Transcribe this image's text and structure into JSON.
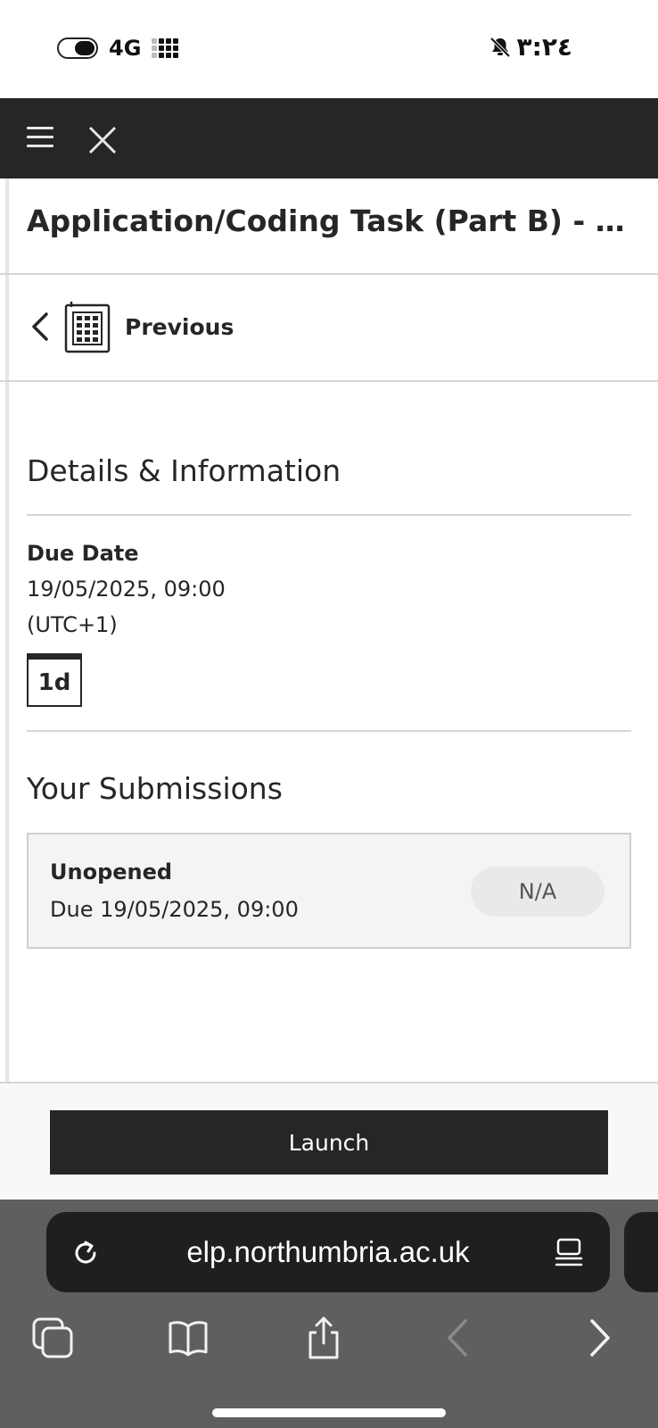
{
  "status_bar": {
    "network": "4G",
    "time": "٣:٢٤"
  },
  "header": {
    "title": "Application/Coding Task (Part B) - Subm..."
  },
  "nav": {
    "previous_label": "Previous"
  },
  "details": {
    "heading": "Details & Information",
    "due_label": "Due Date",
    "due_value": "19/05/2025, 09:00",
    "timezone": "(UTC+1)",
    "countdown_badge": "1d"
  },
  "submissions": {
    "heading": "Your Submissions",
    "items": [
      {
        "status": "Unopened",
        "due": "Due 19/05/2025, 09:00",
        "grade": "N/A"
      }
    ]
  },
  "actions": {
    "launch_label": "Launch"
  },
  "browser": {
    "url": "elp.northumbria.ac.uk"
  },
  "colors": {
    "dark": "#262626",
    "browser_chrome": "#5f5f62",
    "card_bg": "#f4f4f4"
  }
}
